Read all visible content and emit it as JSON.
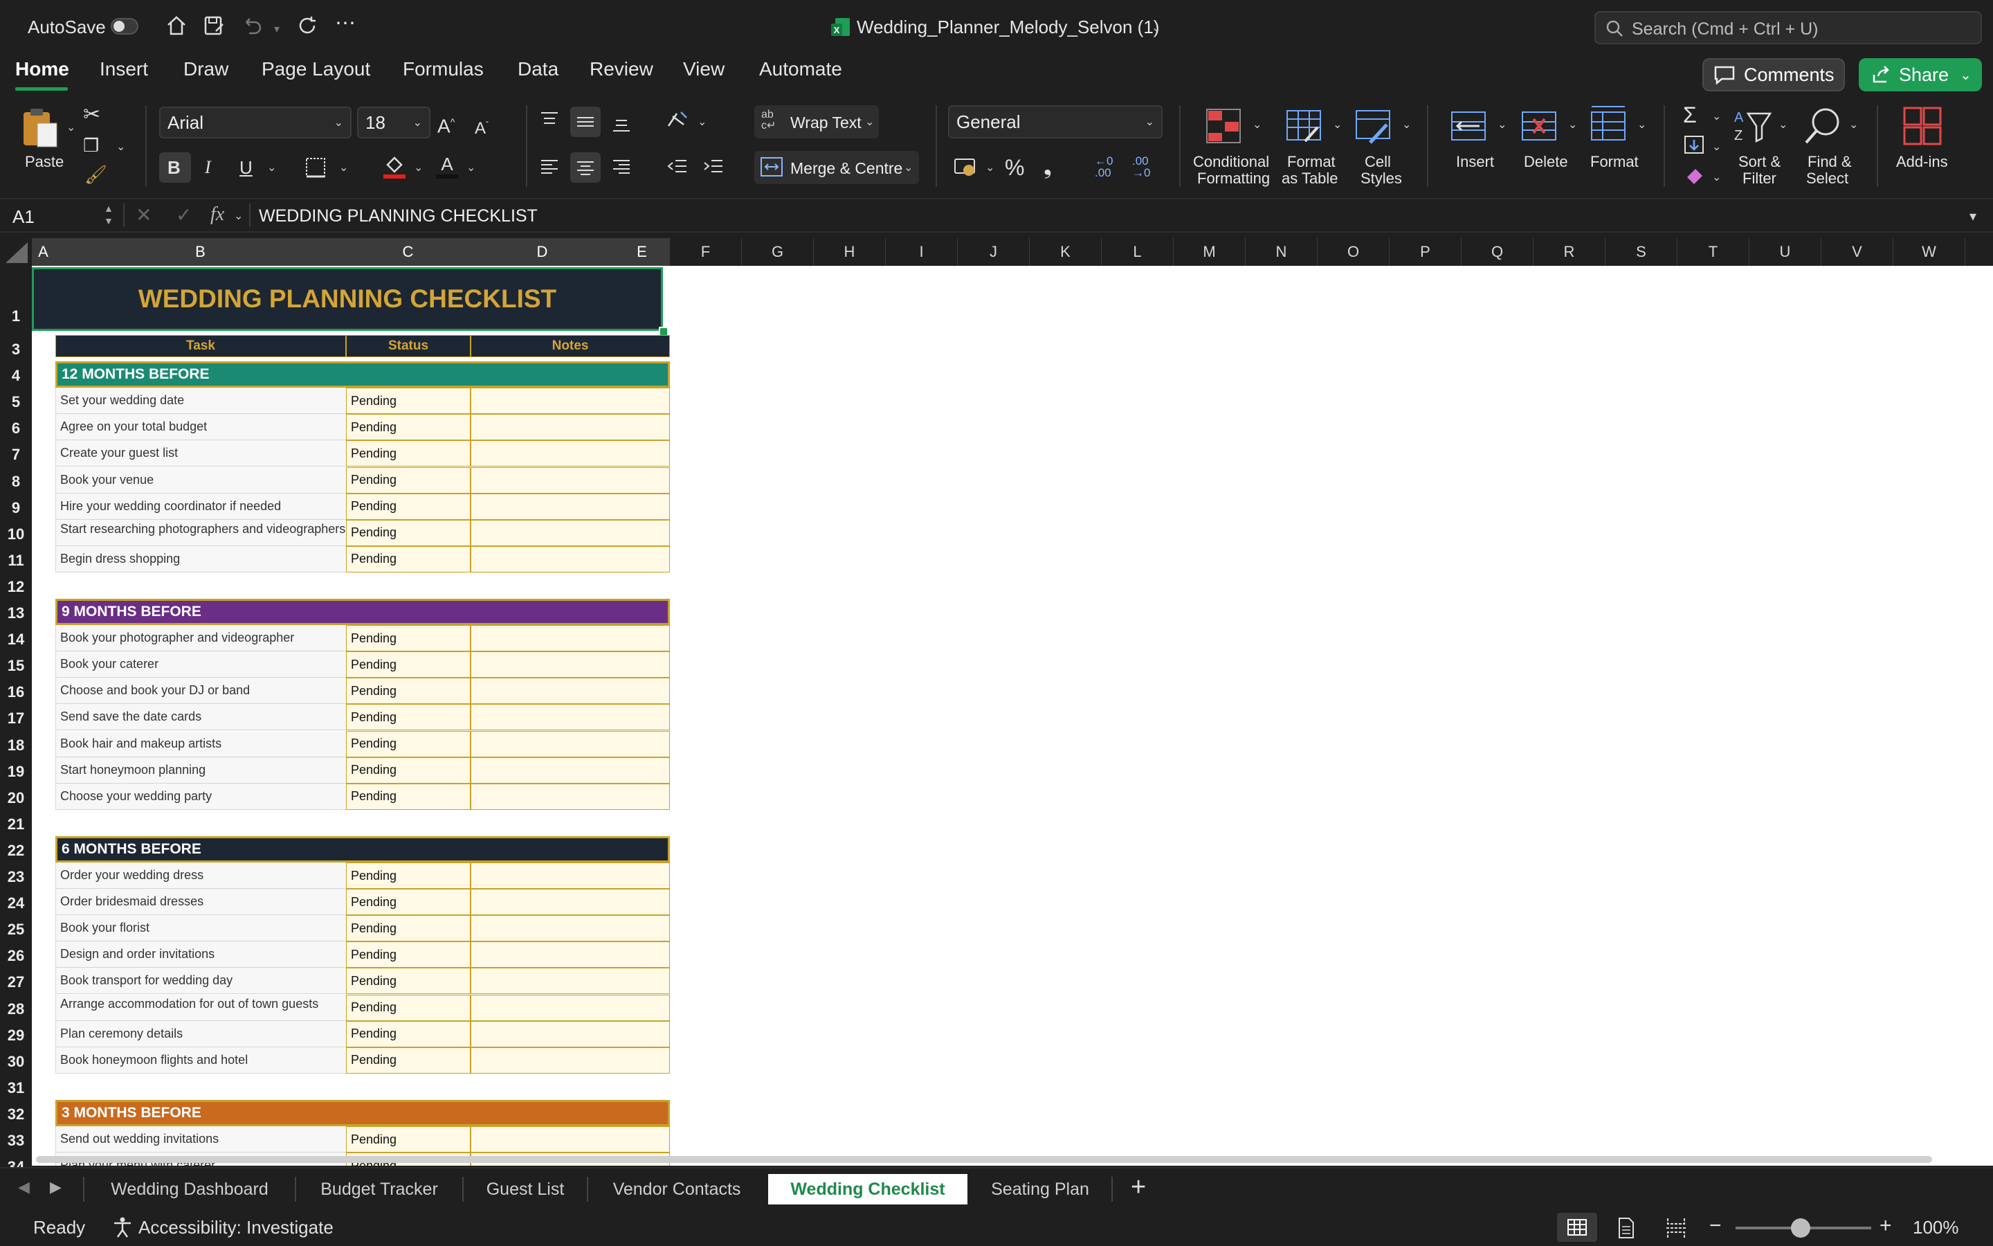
{
  "window": {
    "autosave_label": "AutoSave",
    "file_title": "Wedding_Planner_Melody_Selvon (1)",
    "search_placeholder": "Search (Cmd + Ctrl + U)"
  },
  "tabs": [
    "Home",
    "Insert",
    "Draw",
    "Page Layout",
    "Formulas",
    "Data",
    "Review",
    "View",
    "Automate"
  ],
  "actions": {
    "comments": "Comments",
    "share": "Share"
  },
  "ribbon": {
    "paste": "Paste",
    "font_name": "Arial",
    "font_size": "18",
    "wrap_text": "Wrap Text",
    "merge_centre": "Merge & Centre",
    "number_format": "General",
    "conditional_formatting": [
      "Conditional",
      "Formatting"
    ],
    "format_as_table": [
      "Format",
      "as Table"
    ],
    "cell_styles": [
      "Cell",
      "Styles"
    ],
    "insert": "Insert",
    "delete": "Delete",
    "format": "Format",
    "sort_filter": [
      "Sort &",
      "Filter"
    ],
    "find_select": [
      "Find &",
      "Select"
    ],
    "addins": "Add-ins",
    "bold": "B",
    "italic": "I",
    "underline": "U"
  },
  "formula_bar": {
    "name_box": "A1",
    "fx": "fx",
    "content": "WEDDING PLANNING CHECKLIST"
  },
  "columns": [
    "A",
    "B",
    "C",
    "D",
    "E",
    "F",
    "G",
    "H",
    "I",
    "J",
    "K",
    "L",
    "M",
    "N",
    "O",
    "P",
    "Q",
    "R",
    "S",
    "T",
    "U",
    "V",
    "W"
  ],
  "sheet": {
    "title": "WEDDING PLANNING CHECKLIST",
    "headers": {
      "task": "Task",
      "status": "Status",
      "notes": "Notes"
    },
    "sections": [
      {
        "row": 4,
        "title": "12 MONTHS BEFORE",
        "color": "#1b8a72",
        "tasks": [
          {
            "row": 5,
            "task": "Set your wedding date",
            "status": "Pending"
          },
          {
            "row": 6,
            "task": "Agree on your total budget",
            "status": "Pending"
          },
          {
            "row": 7,
            "task": "Create your guest list",
            "status": "Pending"
          },
          {
            "row": 8,
            "task": "Book your venue",
            "status": "Pending"
          },
          {
            "row": 9,
            "task": "Hire your wedding coordinator if needed",
            "status": "Pending"
          },
          {
            "row": 10,
            "task": "Start researching photographers and videographers",
            "status": "Pending"
          },
          {
            "row": 11,
            "task": "Begin dress shopping",
            "status": "Pending"
          }
        ]
      },
      {
        "row": 13,
        "title": "9 MONTHS BEFORE",
        "color": "#6a2e86",
        "tasks": [
          {
            "row": 14,
            "task": "Book your photographer and videographer",
            "status": "Pending"
          },
          {
            "row": 15,
            "task": "Book your caterer",
            "status": "Pending"
          },
          {
            "row": 16,
            "task": "Choose and book your DJ or band",
            "status": "Pending"
          },
          {
            "row": 17,
            "task": "Send save the date cards",
            "status": "Pending"
          },
          {
            "row": 18,
            "task": "Book hair and makeup artists",
            "status": "Pending"
          },
          {
            "row": 19,
            "task": "Start honeymoon planning",
            "status": "Pending"
          },
          {
            "row": 20,
            "task": "Choose your wedding party",
            "status": "Pending"
          }
        ]
      },
      {
        "row": 22,
        "title": "6 MONTHS BEFORE",
        "color": "#1d2733",
        "tasks": [
          {
            "row": 23,
            "task": "Order your wedding dress",
            "status": "Pending"
          },
          {
            "row": 24,
            "task": "Order bridesmaid dresses",
            "status": "Pending"
          },
          {
            "row": 25,
            "task": "Book your florist",
            "status": "Pending"
          },
          {
            "row": 26,
            "task": "Design and order invitations",
            "status": "Pending"
          },
          {
            "row": 27,
            "task": "Book transport for wedding day",
            "status": "Pending"
          },
          {
            "row": 28,
            "task": "Arrange accommodation for out of town guests",
            "status": "Pending"
          },
          {
            "row": 29,
            "task": "Plan ceremony details",
            "status": "Pending"
          },
          {
            "row": 30,
            "task": "Book honeymoon flights and hotel",
            "status": "Pending"
          }
        ]
      },
      {
        "row": 32,
        "title": "3 MONTHS BEFORE",
        "color": "#c96a1e",
        "tasks": [
          {
            "row": 33,
            "task": "Send out wedding invitations",
            "status": "Pending"
          },
          {
            "row": 34,
            "task": "Plan your menu with caterer",
            "status": "Pending"
          }
        ]
      }
    ]
  },
  "sheet_tabs": [
    "Wedding Dashboard",
    "Budget Tracker",
    "Guest List",
    "Vendor Contacts",
    "Wedding Checklist",
    "Seating Plan"
  ],
  "active_sheet": "Wedding Checklist",
  "status": {
    "ready": "Ready",
    "accessibility": "Accessibility: Investigate",
    "zoom": "100%"
  }
}
